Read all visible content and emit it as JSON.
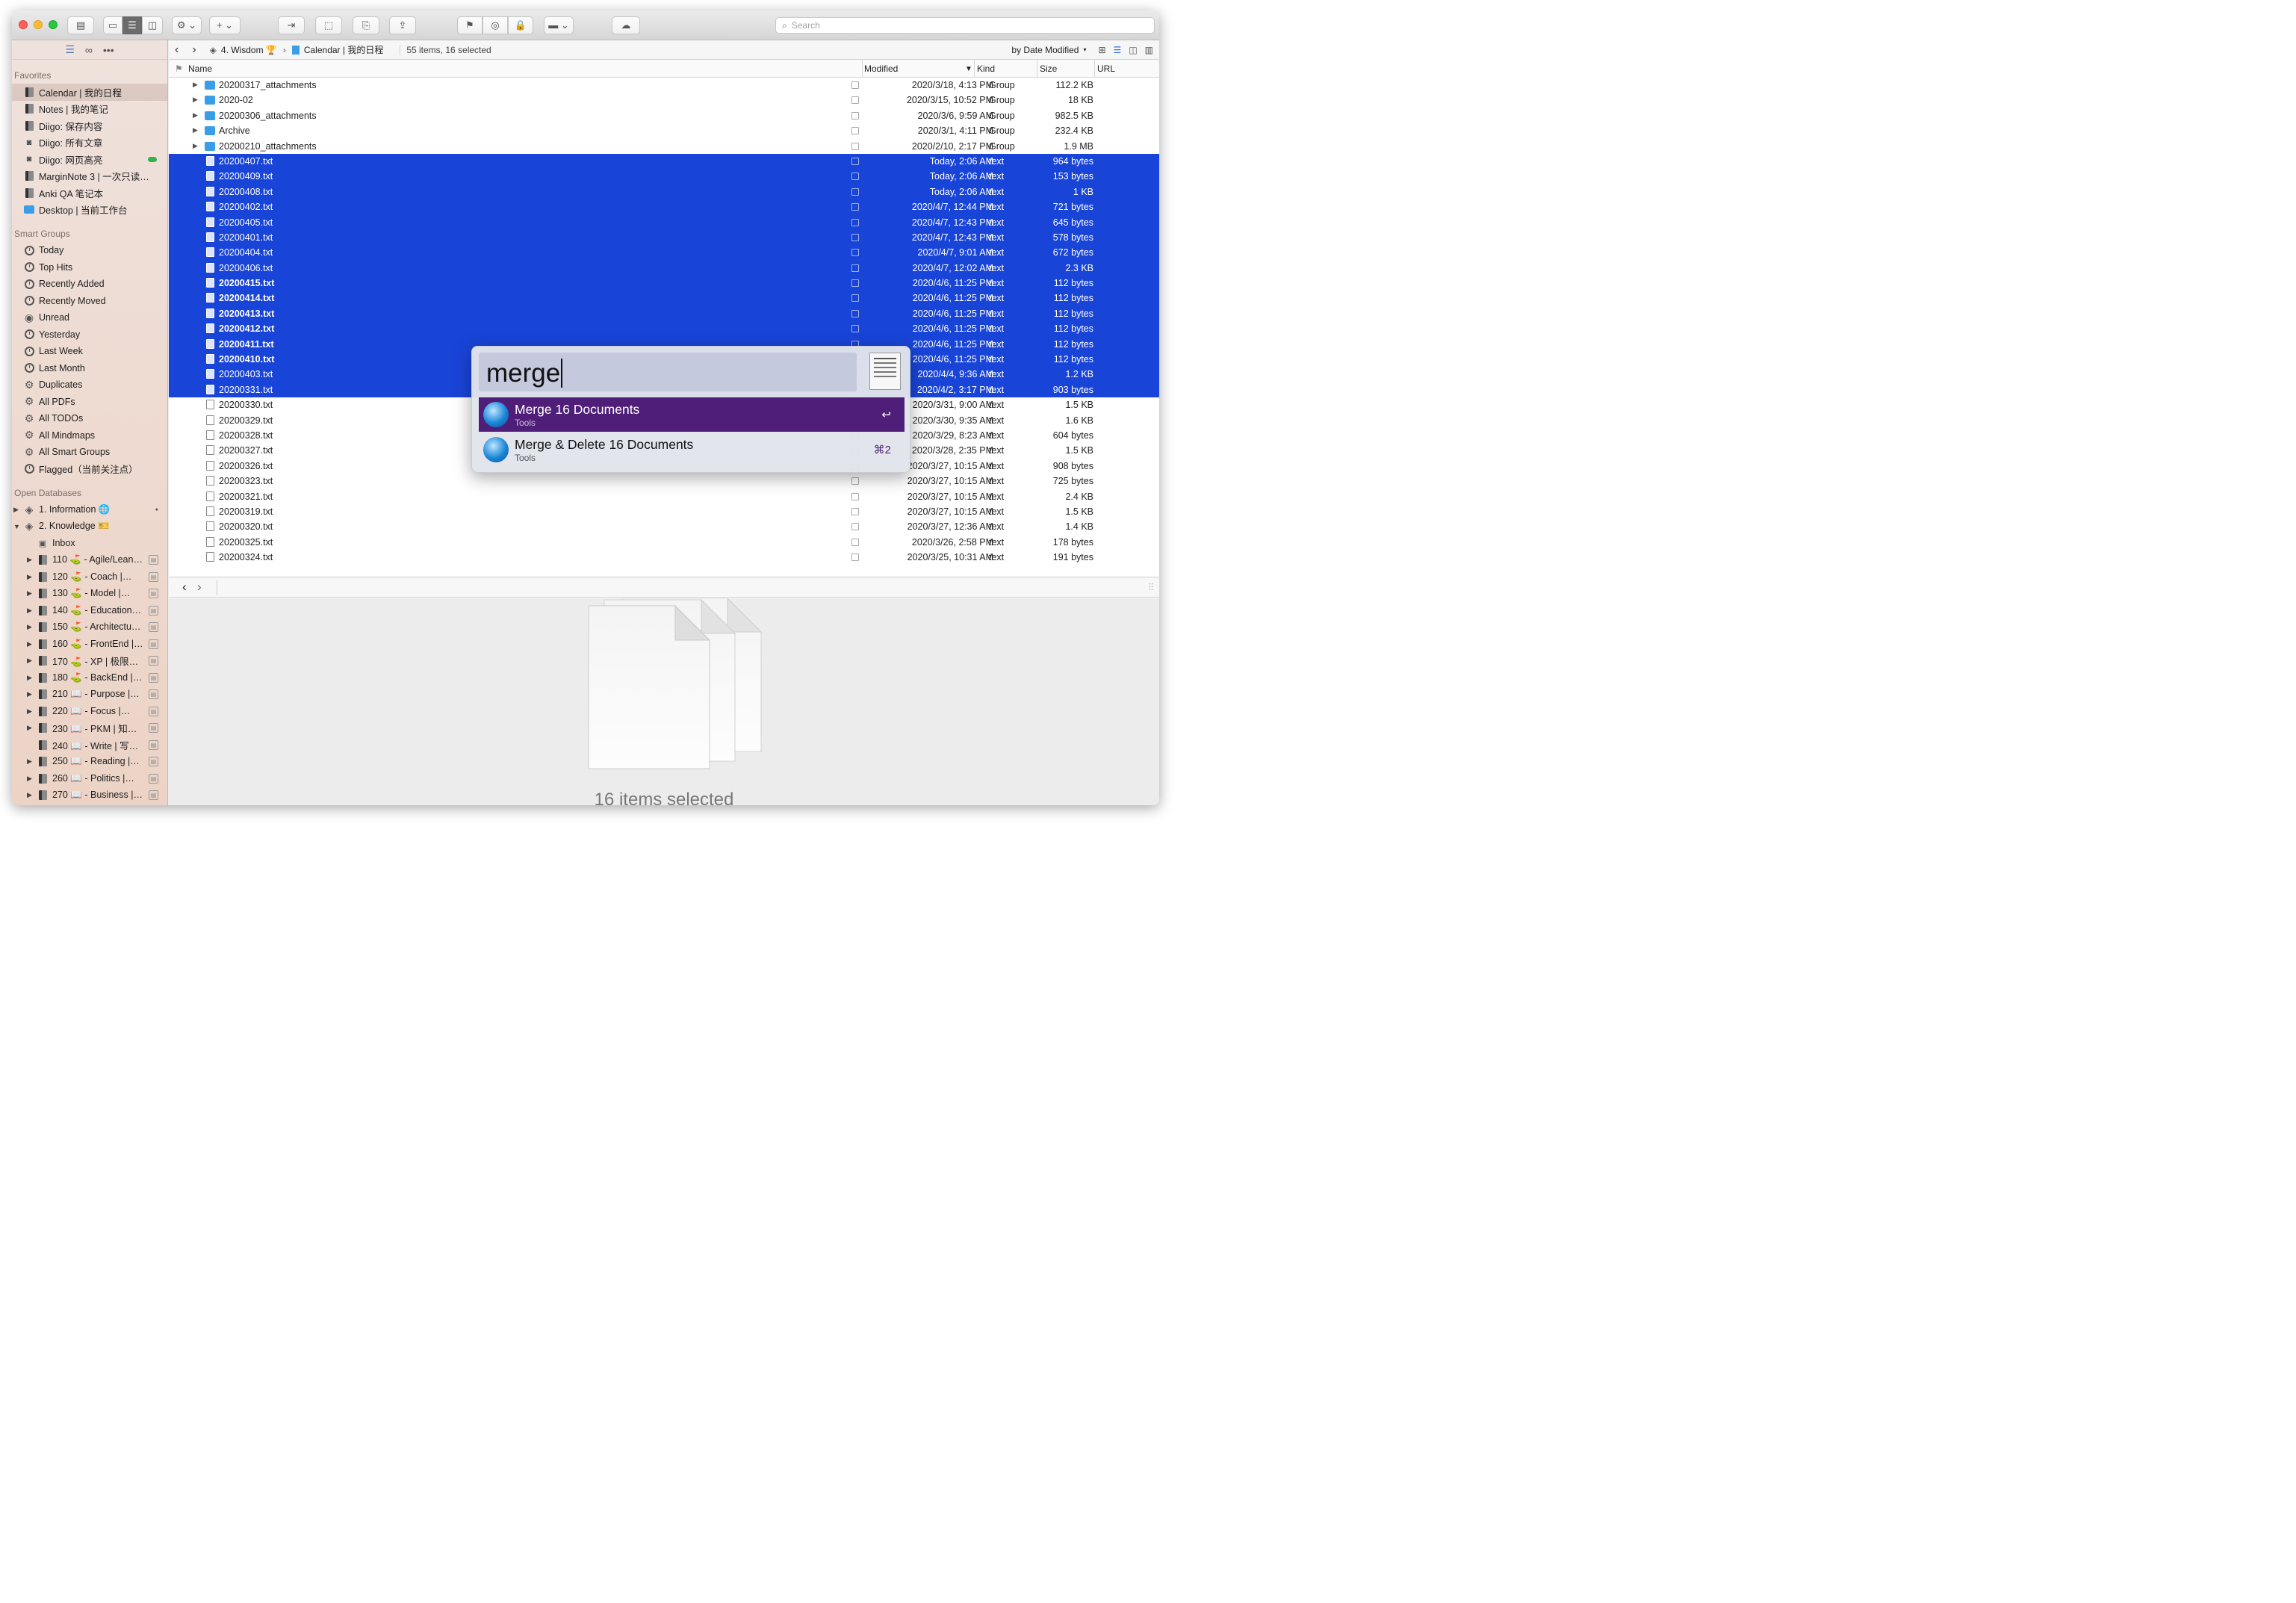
{
  "toolbar": {
    "search_placeholder": "Search"
  },
  "sidebar": {
    "favorites_header": "Favorites",
    "favorites": [
      {
        "label": "Calendar | 我的日程",
        "icon": "database-icon"
      },
      {
        "label": "Notes | 我的笔记",
        "icon": "database-icon"
      },
      {
        "label": "Diigo: 保存内容",
        "icon": "database-icon"
      },
      {
        "label": "Diigo: 所有文章",
        "icon": "rss-feed-icon"
      },
      {
        "label": "Diigo: 网页高亮",
        "icon": "rss-feed-icon"
      },
      {
        "label": "MarginNote 3 | 一次只读…",
        "icon": "database-icon"
      },
      {
        "label": "Anki QA 笔记本",
        "icon": "database-icon"
      },
      {
        "label": "Desktop | 当前工作台",
        "icon": "folder-icon"
      }
    ],
    "smart_header": "Smart Groups",
    "smart_groups": [
      "Today",
      "Top Hits",
      "Recently Added",
      "Recently Moved",
      "Unread",
      "Yesterday",
      "Last Week",
      "Last Month",
      "Duplicates",
      "All PDFs",
      "All TODOs",
      "All Mindmaps",
      "All Smart Groups",
      "Flagged（当前关注点）"
    ],
    "open_header": "Open Databases",
    "databases": [
      {
        "label": "1. Information 🌐"
      },
      {
        "label": "2. Knowledge 🎫"
      }
    ],
    "inbox_label": "Inbox",
    "knowledge_groups": [
      "110 ⛳ - Agile/Lean…",
      "120 ⛳ - Coach |…",
      "130 ⛳ - Model |…",
      "140 ⛳ - Education…",
      "150 ⛳ - Architectu…",
      "160 ⛳ - FrontEnd |…",
      "170 ⛳ - XP | 极限…",
      "180 ⛳ - BackEnd |…",
      "210 📖 - Purpose |…",
      "220 📖 - Focus |…",
      "230 📖 - PKM | 知…",
      "240 📖 - Write | 写…",
      "250 📖 - Reading |…",
      "260 📖 - Politics |…",
      "270 📖 - Business |…"
    ]
  },
  "pathbar": {
    "crumb1": "4. Wisdom 🏆",
    "crumb2": "Calendar | 我的日程",
    "status": "55 items, 16 selected",
    "sort": "by Date Modified"
  },
  "columns": {
    "name": "Name",
    "modified": "Modified",
    "kind": "Kind",
    "size": "Size",
    "url": "URL"
  },
  "files": [
    {
      "name": "20200317_attachments",
      "modified": "2020/3/18, 4:13 PM",
      "kind": "Group",
      "size": "112.2 KB",
      "group": true,
      "selected": false,
      "bold": false
    },
    {
      "name": "2020-02",
      "modified": "2020/3/15, 10:52 PM",
      "kind": "Group",
      "size": "18 KB",
      "group": true,
      "selected": false,
      "bold": false
    },
    {
      "name": "20200306_attachments",
      "modified": "2020/3/6, 9:59 AM",
      "kind": "Group",
      "size": "982.5 KB",
      "group": true,
      "selected": false,
      "bold": false
    },
    {
      "name": "Archive",
      "modified": "2020/3/1, 4:11 PM",
      "kind": "Group",
      "size": "232.4 KB",
      "group": true,
      "selected": false,
      "bold": false
    },
    {
      "name": "20200210_attachments",
      "modified": "2020/2/10, 2:17 PM",
      "kind": "Group",
      "size": "1.9 MB",
      "group": true,
      "selected": false,
      "bold": false
    },
    {
      "name": "20200407.txt",
      "modified": "Today, 2:06 AM",
      "kind": "text",
      "size": "964 bytes",
      "group": false,
      "selected": true,
      "bold": false
    },
    {
      "name": "20200409.txt",
      "modified": "Today, 2:06 AM",
      "kind": "text",
      "size": "153 bytes",
      "group": false,
      "selected": true,
      "bold": false
    },
    {
      "name": "20200408.txt",
      "modified": "Today, 2:06 AM",
      "kind": "text",
      "size": "1 KB",
      "group": false,
      "selected": true,
      "bold": false
    },
    {
      "name": "20200402.txt",
      "modified": "2020/4/7, 12:44 PM",
      "kind": "text",
      "size": "721 bytes",
      "group": false,
      "selected": true,
      "bold": false
    },
    {
      "name": "20200405.txt",
      "modified": "2020/4/7, 12:43 PM",
      "kind": "text",
      "size": "645 bytes",
      "group": false,
      "selected": true,
      "bold": false
    },
    {
      "name": "20200401.txt",
      "modified": "2020/4/7, 12:43 PM",
      "kind": "text",
      "size": "578 bytes",
      "group": false,
      "selected": true,
      "bold": false
    },
    {
      "name": "20200404.txt",
      "modified": "2020/4/7, 9:01 AM",
      "kind": "text",
      "size": "672 bytes",
      "group": false,
      "selected": true,
      "bold": false
    },
    {
      "name": "20200406.txt",
      "modified": "2020/4/7, 12:02 AM",
      "kind": "text",
      "size": "2.3 KB",
      "group": false,
      "selected": true,
      "bold": false
    },
    {
      "name": "20200415.txt",
      "modified": "2020/4/6, 11:25 PM",
      "kind": "text",
      "size": "112 bytes",
      "group": false,
      "selected": true,
      "bold": true
    },
    {
      "name": "20200414.txt",
      "modified": "2020/4/6, 11:25 PM",
      "kind": "text",
      "size": "112 bytes",
      "group": false,
      "selected": true,
      "bold": true
    },
    {
      "name": "20200413.txt",
      "modified": "2020/4/6, 11:25 PM",
      "kind": "text",
      "size": "112 bytes",
      "group": false,
      "selected": true,
      "bold": true
    },
    {
      "name": "20200412.txt",
      "modified": "2020/4/6, 11:25 PM",
      "kind": "text",
      "size": "112 bytes",
      "group": false,
      "selected": true,
      "bold": true
    },
    {
      "name": "20200411.txt",
      "modified": "2020/4/6, 11:25 PM",
      "kind": "text",
      "size": "112 bytes",
      "group": false,
      "selected": true,
      "bold": true
    },
    {
      "name": "20200410.txt",
      "modified": "2020/4/6, 11:25 PM",
      "kind": "text",
      "size": "112 bytes",
      "group": false,
      "selected": true,
      "bold": true
    },
    {
      "name": "20200403.txt",
      "modified": "2020/4/4, 9:36 AM",
      "kind": "text",
      "size": "1.2 KB",
      "group": false,
      "selected": true,
      "bold": false
    },
    {
      "name": "20200331.txt",
      "modified": "2020/4/2, 3:17 PM",
      "kind": "text",
      "size": "903 bytes",
      "group": false,
      "selected": true,
      "bold": false
    },
    {
      "name": "20200330.txt",
      "modified": "2020/3/31, 9:00 AM",
      "kind": "text",
      "size": "1.5 KB",
      "group": false,
      "selected": false,
      "bold": false
    },
    {
      "name": "20200329.txt",
      "modified": "2020/3/30, 9:35 AM",
      "kind": "text",
      "size": "1.6 KB",
      "group": false,
      "selected": false,
      "bold": false
    },
    {
      "name": "20200328.txt",
      "modified": "2020/3/29, 8:23 AM",
      "kind": "text",
      "size": "604 bytes",
      "group": false,
      "selected": false,
      "bold": false
    },
    {
      "name": "20200327.txt",
      "modified": "2020/3/28, 2:35 PM",
      "kind": "text",
      "size": "1.5 KB",
      "group": false,
      "selected": false,
      "bold": false
    },
    {
      "name": "20200326.txt",
      "modified": "2020/3/27, 10:15 AM",
      "kind": "text",
      "size": "908 bytes",
      "group": false,
      "selected": false,
      "bold": false
    },
    {
      "name": "20200323.txt",
      "modified": "2020/3/27, 10:15 AM",
      "kind": "text",
      "size": "725 bytes",
      "group": false,
      "selected": false,
      "bold": false
    },
    {
      "name": "20200321.txt",
      "modified": "2020/3/27, 10:15 AM",
      "kind": "text",
      "size": "2.4 KB",
      "group": false,
      "selected": false,
      "bold": false
    },
    {
      "name": "20200319.txt",
      "modified": "2020/3/27, 10:15 AM",
      "kind": "text",
      "size": "1.5 KB",
      "group": false,
      "selected": false,
      "bold": false
    },
    {
      "name": "20200320.txt",
      "modified": "2020/3/27, 12:36 AM",
      "kind": "text",
      "size": "1.4 KB",
      "group": false,
      "selected": false,
      "bold": false
    },
    {
      "name": "20200325.txt",
      "modified": "2020/3/26, 2:58 PM",
      "kind": "text",
      "size": "178 bytes",
      "group": false,
      "selected": false,
      "bold": false
    },
    {
      "name": "20200324.txt",
      "modified": "2020/3/25, 10:31 AM",
      "kind": "text",
      "size": "191 bytes",
      "group": false,
      "selected": false,
      "bold": false
    }
  ],
  "popup": {
    "query": "merge",
    "results": [
      {
        "title": "Merge 16 Documents",
        "subtitle": "Tools",
        "shortcut": "↩"
      },
      {
        "title": "Merge & Delete 16 Documents",
        "subtitle": "Tools",
        "shortcut": "⌘2"
      }
    ]
  },
  "preview": {
    "caption": "16 items selected"
  },
  "colors": {
    "selection": "#1944d8",
    "popup_highlight": "#4f1e78",
    "sidebar_bg": "#ecd6cb"
  }
}
